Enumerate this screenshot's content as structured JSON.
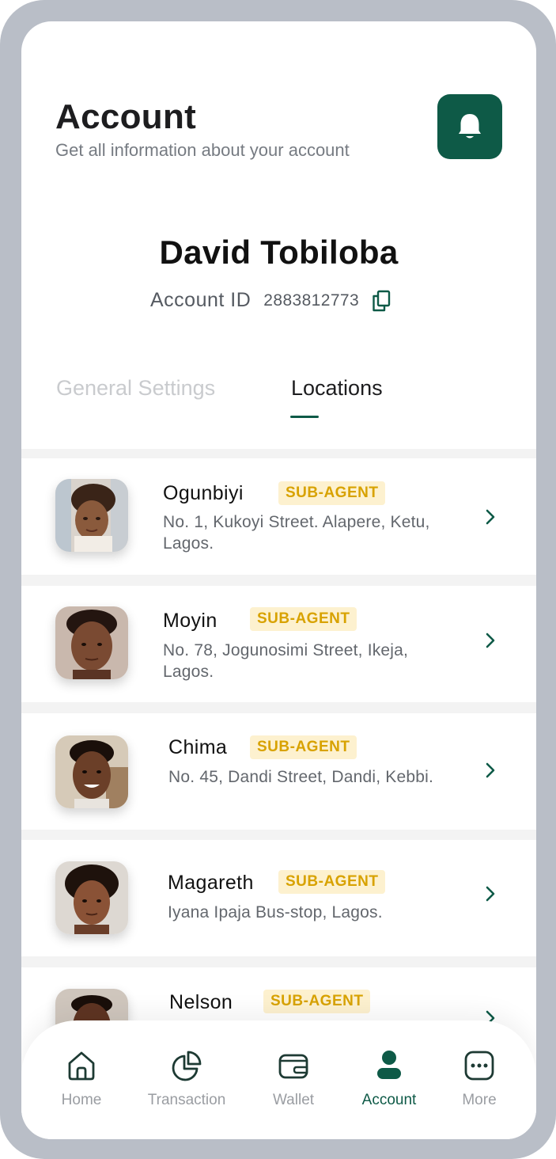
{
  "header": {
    "title": "Account",
    "subtitle": "Get all information about your account",
    "notification_icon": "bell-icon"
  },
  "profile": {
    "name": "David Tobiloba",
    "account_id_label": "Account  ID",
    "account_id": "2883812773",
    "copy_icon": "copy-icon"
  },
  "tabs": [
    {
      "label": "General Settings",
      "active": false
    },
    {
      "label": "Locations",
      "active": true
    }
  ],
  "locations": [
    {
      "name": "Ogunbiyi",
      "badge": "SUB-AGENT",
      "address": "No. 1, Kukoyi Street. Alapere, Ketu, Lagos."
    },
    {
      "name": "Moyin",
      "badge": "SUB-AGENT",
      "address": "No. 78, Jogunosimi Street, Ikeja, Lagos."
    },
    {
      "name": "Chima",
      "badge": "SUB-AGENT",
      "address": "No. 45, Dandi  Street, Dandi, Kebbi."
    },
    {
      "name": "Magareth",
      "badge": "SUB-AGENT",
      "address": "Iyana Ipaja Bus-stop, Lagos."
    },
    {
      "name": "Nelson",
      "badge": "SUB-AGENT",
      "address": ""
    }
  ],
  "bottom_nav": [
    {
      "label": "Home",
      "icon": "home-icon",
      "active": false
    },
    {
      "label": "Transaction",
      "icon": "pie-chart-icon",
      "active": false
    },
    {
      "label": "Wallet",
      "icon": "wallet-icon",
      "active": false
    },
    {
      "label": "Account",
      "icon": "user-icon",
      "active": true
    },
    {
      "label": "More",
      "icon": "more-icon",
      "active": false
    }
  ],
  "colors": {
    "accent": "#0e5a47",
    "badge_bg": "#fdf1cf",
    "badge_text": "#d8a200",
    "frame": "#b9bec7"
  }
}
